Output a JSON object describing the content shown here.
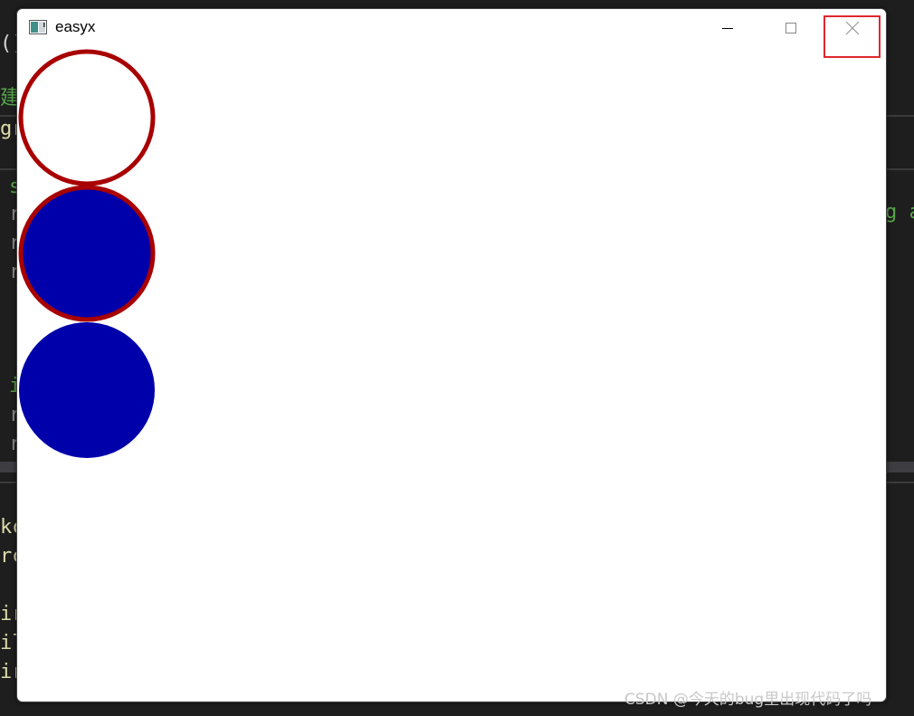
{
  "window": {
    "title": "easyx",
    "minimize_label": "Minimize",
    "maximize_label": "Maximize",
    "close_label": "Close",
    "highlight_color": "#e0262e"
  },
  "canvas": {
    "circles": [
      {
        "style": "outline",
        "stroke": "#a80000",
        "fill": "none"
      },
      {
        "style": "filled-with-outline",
        "stroke": "#a80000",
        "fill": "#0000aa"
      },
      {
        "style": "filled",
        "stroke": "none",
        "fill": "#0000aa"
      }
    ]
  },
  "background_code": {
    "line_a": "()",
    "line_b": "建",
    "line_c": "gr",
    "line_d": "s",
    "line_e": "r",
    "line_f": "r",
    "line_g": "r",
    "line_h": "i",
    "line_i": "r",
    "line_j": "r",
    "line_k": "kc",
    "line_l": "rc",
    "line_m": "ir",
    "line_n": "il",
    "line_o": "ir",
    "right_fragment": "g a"
  },
  "watermark": "CSDN @今天的bug里出现代码了吗"
}
